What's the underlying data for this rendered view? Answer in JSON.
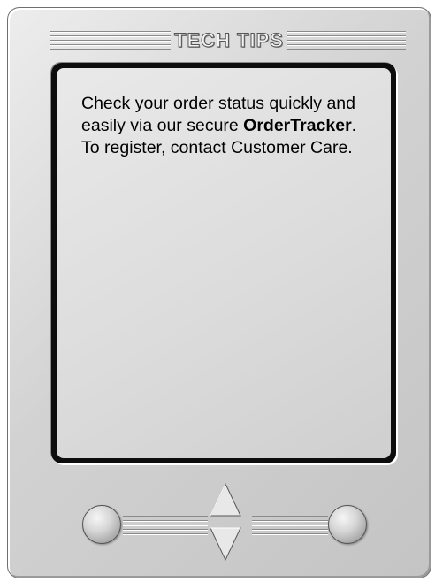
{
  "header": {
    "title": "TECH TIPS"
  },
  "tip": {
    "text_before": "Check your order status quickly and easily via our secure ",
    "highlight": "OrderTracker",
    "text_after": ". To register, contact Customer Care."
  },
  "navigation": {
    "prev_icon": "circle-button-icon",
    "next_icon": "circle-button-icon",
    "up_icon": "triangle-up-icon",
    "down_icon": "triangle-down-icon"
  },
  "colors": {
    "device_body": "#d2d2d2",
    "screen_bezel": "#0d0d0d",
    "screen_fill": "#dcdcdc",
    "text": "#000000"
  }
}
